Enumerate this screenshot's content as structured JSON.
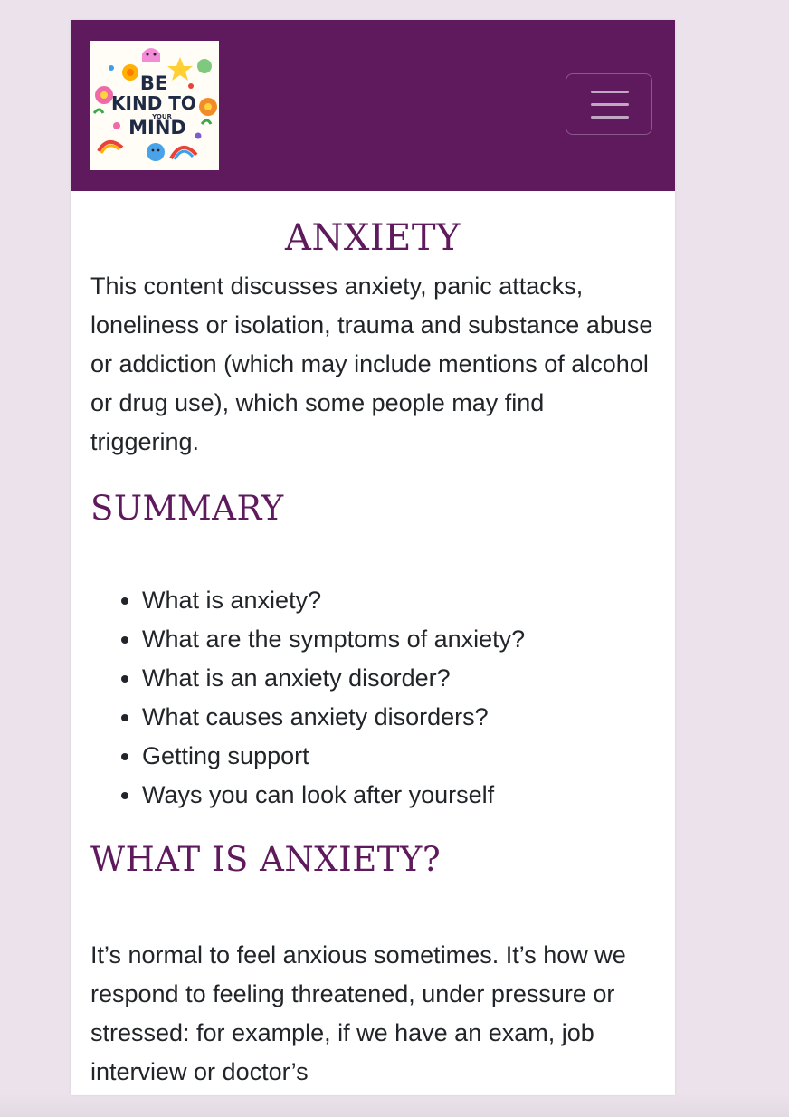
{
  "logo": {
    "line1": "BE",
    "line2": "KIND TO",
    "line3": "YOUR",
    "line4": "MIND"
  },
  "page": {
    "title": "ANXIETY",
    "warning": "This content discusses anxiety, panic attacks, loneliness or isolation, trauma and substance abuse or addiction (which may include mentions of alcohol or drug use), which some people may find triggering."
  },
  "summary": {
    "heading": "SUMMARY",
    "items": [
      "What is anxiety?",
      "What are the symptoms of anxiety?",
      "What is an anxiety disorder?",
      "What causes anxiety disorders?",
      "Getting support",
      "Ways you can look after yourself"
    ]
  },
  "what_is_anxiety": {
    "heading": "WHAT IS ANXIETY?",
    "text": "It’s normal to feel anxious sometimes. It’s how we respond to feeling threatened, under pressure or stressed: for example, if we have an exam, job interview or doctor’s"
  },
  "colors": {
    "brand": "#5e1a5c",
    "page_background": "#ece2ec",
    "text": "#212529"
  },
  "icons": {
    "menu": "hamburger-icon"
  }
}
